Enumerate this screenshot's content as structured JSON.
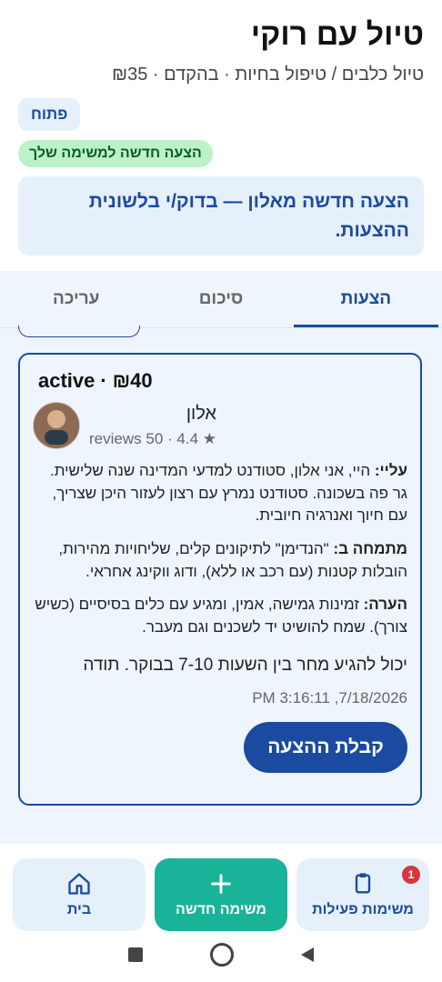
{
  "header": {
    "title": "טיול עם רוקי",
    "subtitle": "טיול כלבים / טיפול בחיות · בהקדם · ₪35",
    "status_chip": "פתוח",
    "new_chip": "הצעה חדשה למשימה שלך",
    "notice": "הצעה חדשה מאלון — בדוק/י בלשונית ההצעות."
  },
  "tabs": [
    "הצעות",
    "סיכום",
    "עריכה"
  ],
  "offer": {
    "header_price": "₪40",
    "header_status": "active",
    "name": "אלון",
    "rating": "★ 4.4 · 50 reviews",
    "about_label": "עליי:",
    "about_text": "היי, אני אלון, סטודנט למדעי המדינה שנה שלישית. גר פה בשכונה. סטודנט נמרץ עם רצון לעזור היכן שצריך, עם חיוך ואנרגיה חיובית.",
    "expert_label": "מתמחה ב:",
    "expert_text": "\"הנדימן\" לתיקונים קלים, שליחויות מהירות, הובלות קטנות (עם רכב או ללא), ודוג ווקינג אחראי.",
    "note_label": "הערה:",
    "note_text": "זמינות גמישה, אמין, ומגיע עם כלים בסיסיים (כשיש צורך). שמח להושיט יד לשכנים וגם מעבר.",
    "message": "יכול להגיע מחר בין השעות 7-10 בבוקר. תודה",
    "timestamp": "7/18/2026, 3:16:11 PM",
    "accept_label": "קבלת ההצעה"
  },
  "bottom_nav": {
    "active_tasks": "משימות פעילות",
    "new_task": "משימה חדשה",
    "home": "בית",
    "badge": "1"
  },
  "colors": {
    "primary": "#1b4aa1",
    "accent": "#19b39a",
    "bg_light": "#e6f0fb",
    "success": "#bdf1c7",
    "badge": "#d7373a"
  },
  "icons": {
    "avatar": "user-avatar",
    "home": "home-icon",
    "plus": "plus-icon",
    "clipboard": "clipboard-icon"
  }
}
